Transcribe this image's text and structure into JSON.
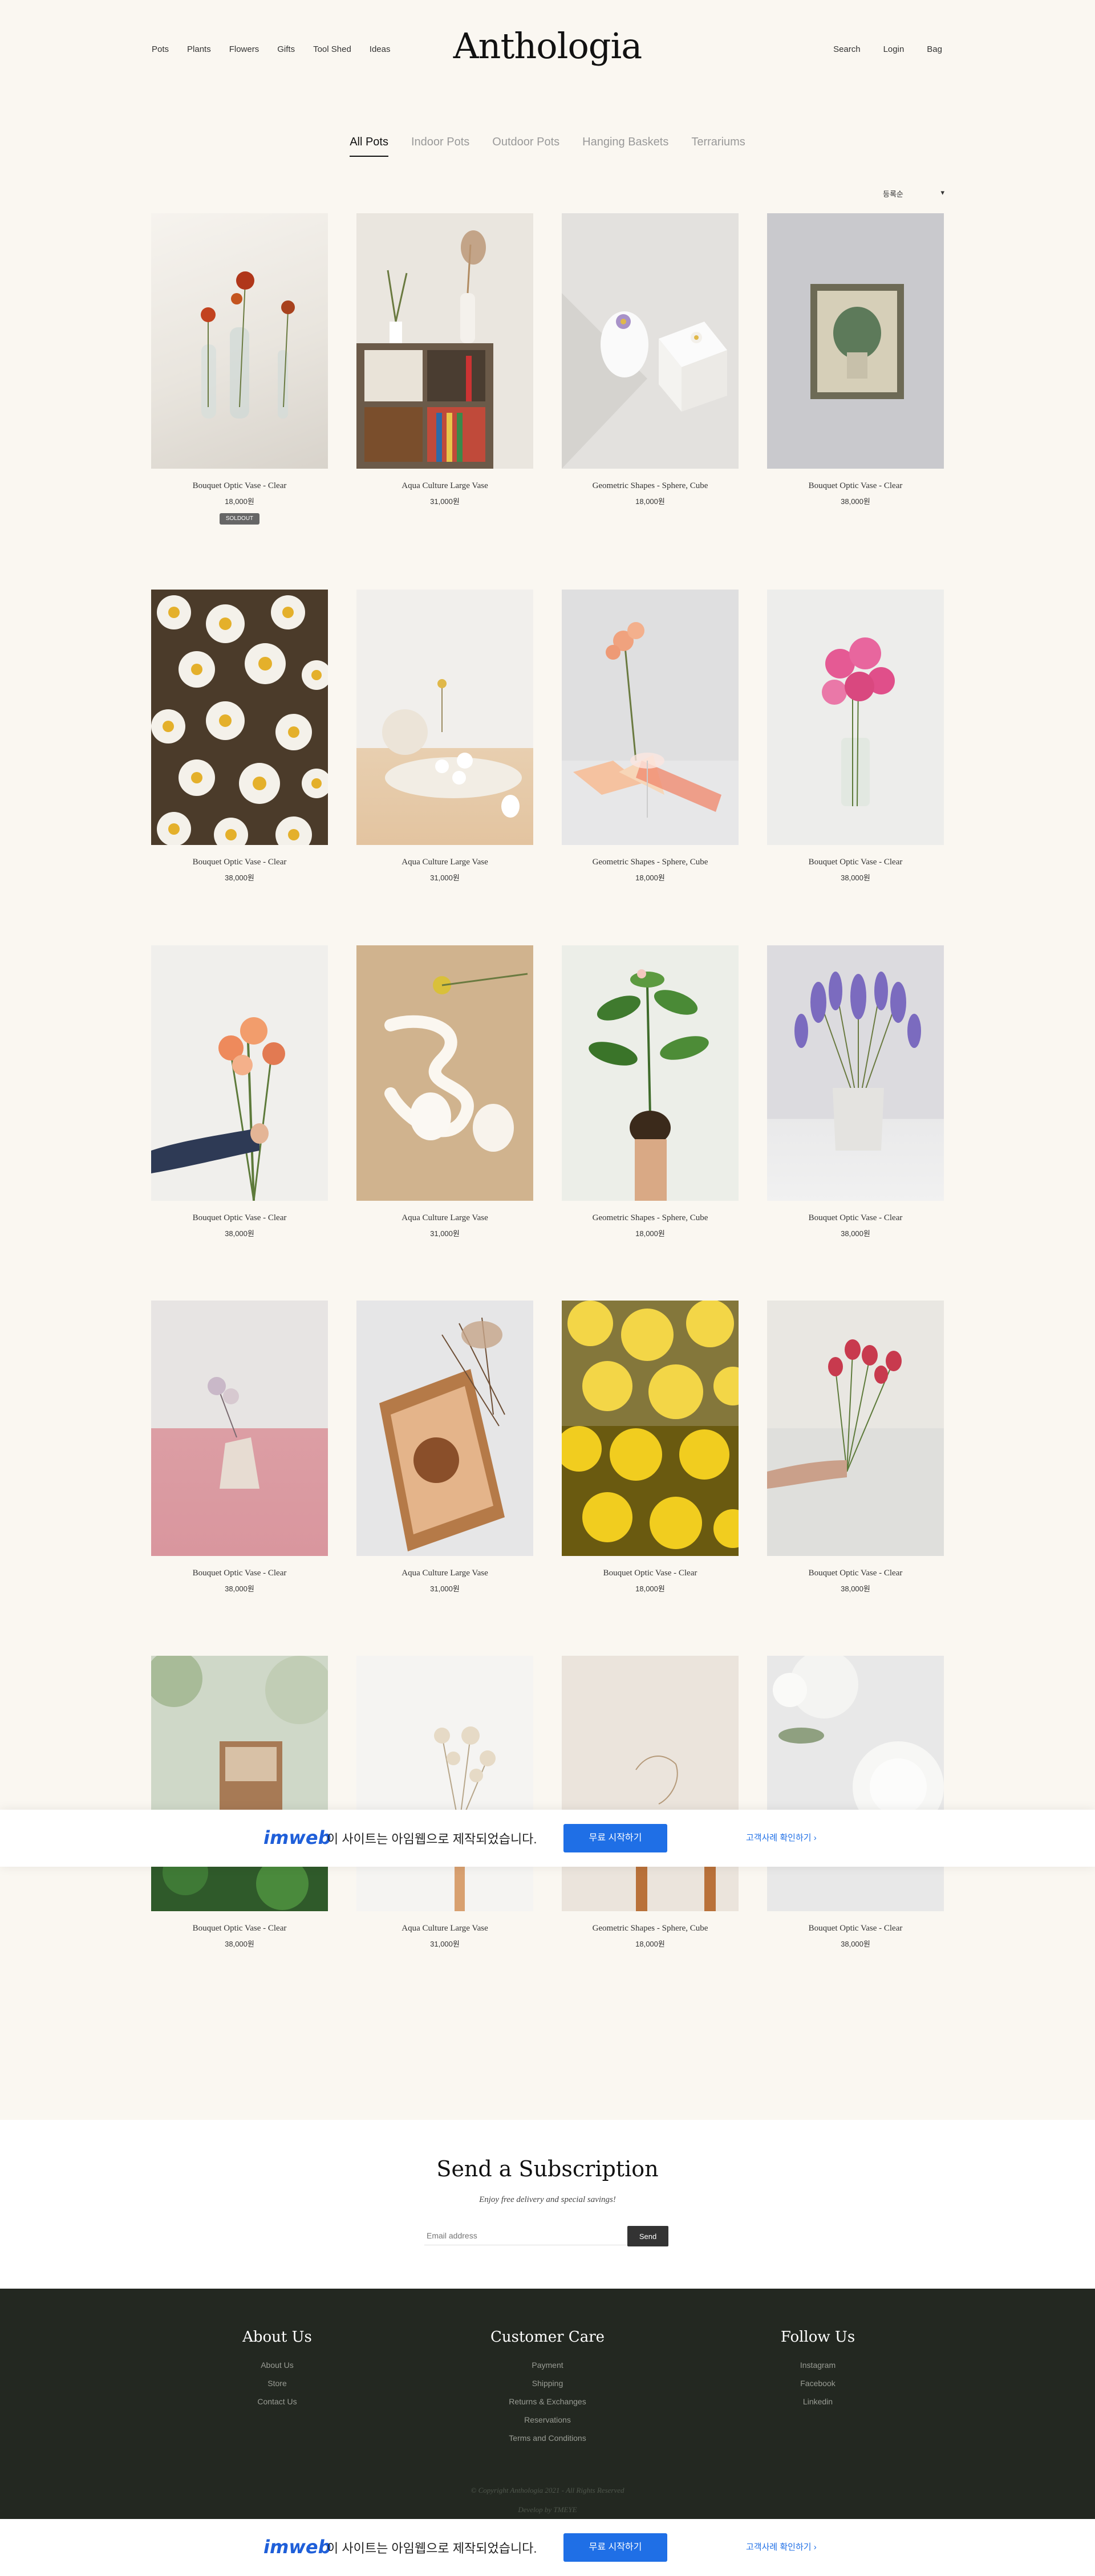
{
  "header": {
    "logo": "Anthologia",
    "nav_left": [
      "Pots",
      "Plants",
      "Flowers",
      "Gifts",
      "Tool Shed",
      "Ideas"
    ],
    "nav_right": [
      "Search",
      "Login",
      "Bag"
    ]
  },
  "tabs": [
    "All Pots",
    "Indoor Pots",
    "Outdoor Pots",
    "Hanging Baskets",
    "Terrariums"
  ],
  "active_tab": "All Pots",
  "sort": {
    "label": "등록순",
    "arrow": "▾"
  },
  "products": [
    {
      "name": "Bouquet Optic Vase - Clear",
      "price": "18,000원",
      "badge": "SOLDOUT"
    },
    {
      "name": "Aqua Culture Large Vase",
      "price": "31,000원"
    },
    {
      "name": "Geometric Shapes - Sphere, Cube",
      "price": "18,000원"
    },
    {
      "name": "Bouquet Optic Vase - Clear",
      "price": "38,000원"
    },
    {
      "name": "Bouquet Optic Vase - Clear",
      "price": "38,000원"
    },
    {
      "name": "Aqua Culture Large Vase",
      "price": "31,000원"
    },
    {
      "name": "Geometric Shapes - Sphere, Cube",
      "price": "18,000원"
    },
    {
      "name": "Bouquet Optic Vase - Clear",
      "price": "38,000원"
    },
    {
      "name": "Bouquet Optic Vase - Clear",
      "price": "38,000원"
    },
    {
      "name": "Aqua Culture Large Vase",
      "price": "31,000원"
    },
    {
      "name": "Geometric Shapes - Sphere, Cube",
      "price": "18,000원"
    },
    {
      "name": "Bouquet Optic Vase - Clear",
      "price": "38,000원"
    },
    {
      "name": "Bouquet Optic Vase - Clear",
      "price": "38,000원"
    },
    {
      "name": "Aqua Culture Large Vase",
      "price": "31,000원"
    },
    {
      "name": "Bouquet Optic Vase - Clear",
      "price": "18,000원"
    },
    {
      "name": "Bouquet Optic Vase - Clear",
      "price": "38,000원"
    },
    {
      "name": "Bouquet Optic Vase - Clear",
      "price": "38,000원"
    },
    {
      "name": "Aqua Culture Large Vase",
      "price": "31,000원"
    },
    {
      "name": "Geometric Shapes - Sphere, Cube",
      "price": "18,000원"
    },
    {
      "name": "Bouquet Optic Vase - Clear",
      "price": "38,000원"
    }
  ],
  "banner": {
    "logo": "imweb",
    "text": "이 사이트는 아임웹으로 제작되었습니다.",
    "button": "무료 시작하기",
    "link": "고객사례 확인하기"
  },
  "subscription": {
    "title": "Send a Subscription",
    "desc": "Enjoy free delivery and special savings!",
    "placeholder": "Email address",
    "button": "Send"
  },
  "footer": {
    "columns": [
      {
        "title": "About Us",
        "links": [
          "About Us",
          "Store",
          "Contact Us"
        ]
      },
      {
        "title": "Customer Care",
        "links": [
          "Payment",
          "Shipping",
          "Returns & Exchanges",
          "Reservations",
          "Terms and Conditions"
        ]
      },
      {
        "title": "Follow Us",
        "links": [
          "Instagram",
          "Facebook",
          "Linkedin"
        ]
      }
    ],
    "copyright": "© Copyright Anthologia 2021 - All Rights Reserved",
    "designer": "Develop by TMEYE"
  },
  "colors": {
    "background": "#faf7f1",
    "footer": "#232821",
    "accent": "#1f6fe6"
  }
}
